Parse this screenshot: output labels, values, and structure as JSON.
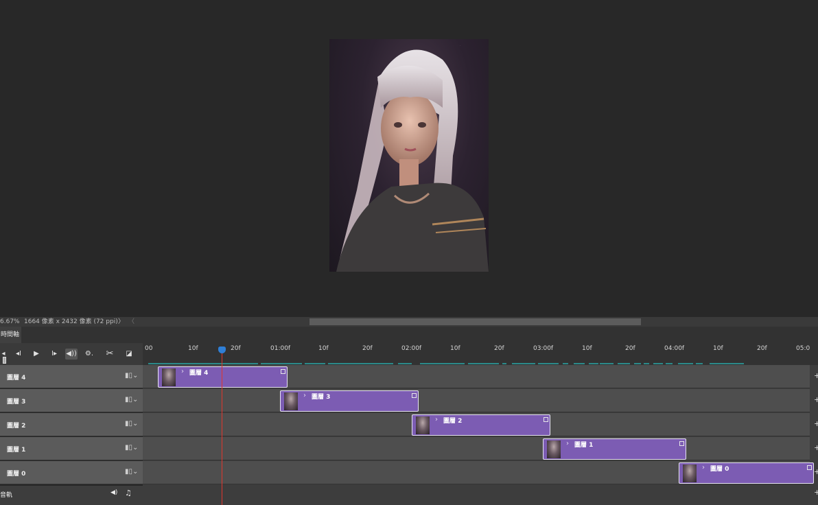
{
  "status": {
    "zoom": "6.67%",
    "dimensions": "1664 像素 x 2432 像素 (72 ppi)",
    "nav_right": "〉",
    "nav_left": "〈"
  },
  "panel": {
    "tab_label": "時間軸"
  },
  "controls": {
    "first_frame": "◂",
    "prev_frame": "◂Ι",
    "play": "▶",
    "next_frame": "Ι▸",
    "audio": "◀))",
    "settings": "⚙.",
    "split": "✂",
    "transition": "◪"
  },
  "ruler": {
    "ticks": [
      {
        "label": "00"
      },
      {
        "label": "10f"
      },
      {
        "label": "20f"
      },
      {
        "label": "01:00f"
      },
      {
        "label": "10f"
      },
      {
        "label": "20f"
      },
      {
        "label": "02:00f"
      },
      {
        "label": "10f"
      },
      {
        "label": "20f"
      },
      {
        "label": "03:00f"
      },
      {
        "label": "10f"
      },
      {
        "label": "20f"
      },
      {
        "label": "04:00f"
      },
      {
        "label": "10f"
      },
      {
        "label": "20f"
      },
      {
        "label": "05:0"
      }
    ]
  },
  "tracks": [
    {
      "name": "圖層 4",
      "clip_label": "圖層 4"
    },
    {
      "name": "圖層 3",
      "clip_label": "圖層 3"
    },
    {
      "name": "圖層 2",
      "clip_label": "圖層 2"
    },
    {
      "name": "圖層 1",
      "clip_label": "圖層 1"
    },
    {
      "name": "圖層 0",
      "clip_label": "圖層 0"
    }
  ],
  "audio_track": {
    "name": "音軌",
    "speaker": "◀)",
    "note": "♫"
  },
  "icons": {
    "film": "film-icon",
    "add": "+",
    "chevron": "›"
  },
  "colors": {
    "clip": "#7c5cb3",
    "playhead": "#e0362d",
    "playhead_knob": "#2f7fd6",
    "cache": "#2b8a8a"
  }
}
